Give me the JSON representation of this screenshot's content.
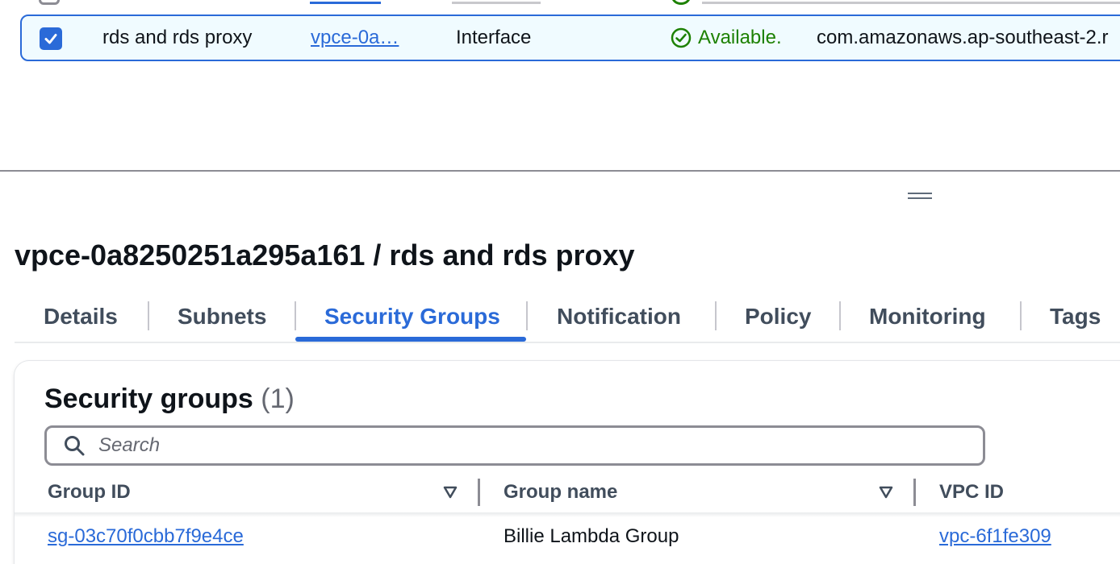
{
  "endpoints_table": {
    "selected_row": {
      "checked": true,
      "name": "rds and rds proxy",
      "endpoint_id": "vpce-0a…",
      "type": "Interface",
      "status": "Available.",
      "service_name": "com.amazonaws.ap-southeast-2.r"
    }
  },
  "details_panel": {
    "title": "vpce-0a8250251a295a161 / rds and rds proxy",
    "tabs": [
      {
        "label": "Details"
      },
      {
        "label": "Subnets"
      },
      {
        "label": "Security Groups",
        "active": true
      },
      {
        "label": "Notification"
      },
      {
        "label": "Policy"
      },
      {
        "label": "Monitoring"
      },
      {
        "label": "Tags"
      }
    ],
    "security_groups": {
      "heading": "Security groups",
      "count": "(1)",
      "search_placeholder": "Search",
      "columns": [
        "Group ID",
        "Group name",
        "VPC ID"
      ],
      "rows": [
        {
          "group_id": "sg-03c70f0cbb7f9e4ce",
          "group_name": "Billie Lambda Group",
          "vpc_id": "vpc-6f1fe309"
        }
      ]
    }
  },
  "colors": {
    "link": "#2a6ad8",
    "success": "#1d8102",
    "selected_row_bg": "#f0fbff",
    "border": "#8c8c94"
  },
  "icons": [
    "checkbox-checked-icon",
    "status-available-icon",
    "drag-handle-icon",
    "search-icon",
    "sort-icon"
  ]
}
